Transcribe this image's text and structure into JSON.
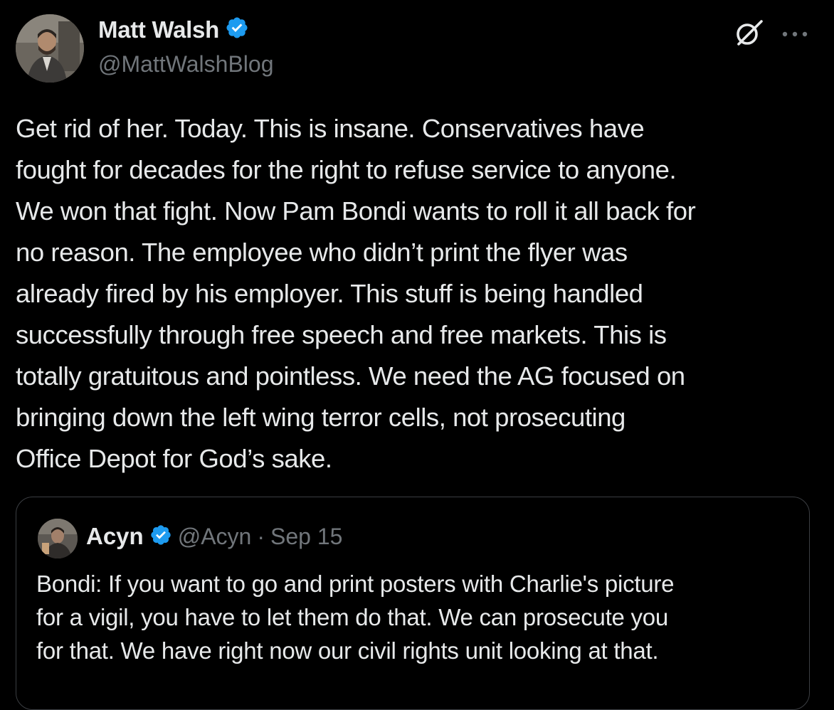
{
  "author": {
    "name": "Matt Walsh",
    "handle": "@MattWalshBlog",
    "verified": true
  },
  "colors": {
    "background": "#000000",
    "text": "#e7e9ea",
    "muted": "#71767b",
    "verified_badge": "#1d9bf0",
    "quote_border": "#3b3e42"
  },
  "icons": {
    "grok": "grok-icon",
    "more": "more-icon",
    "verified": "verified-badge-icon"
  },
  "tweet": {
    "lines": [
      "Get rid of her. Today. This is insane. Conservatives have",
      "fought for decades for the right to refuse service to anyone.",
      "We won that fight. Now Pam Bondi wants to roll it all back for",
      "no reason. The employee who didn’t print the flyer was",
      "already fired by his employer. This stuff is being handled",
      "successfully through free speech and free markets. This is",
      "totally gratuitous and pointless. We need the AG focused on",
      "bringing down the left wing terror cells, not prosecuting",
      "Office Depot for God’s sake."
    ]
  },
  "quote": {
    "name": "Acyn",
    "handle": "@Acyn",
    "separator": "·",
    "date": "Sep 15",
    "verified": true,
    "lines": [
      "Bondi: If you want to go and print posters with Charlie's picture",
      "for a vigil, you have to let them do that. We can prosecute you",
      "for that. We have right now our civil rights unit looking at that."
    ]
  }
}
